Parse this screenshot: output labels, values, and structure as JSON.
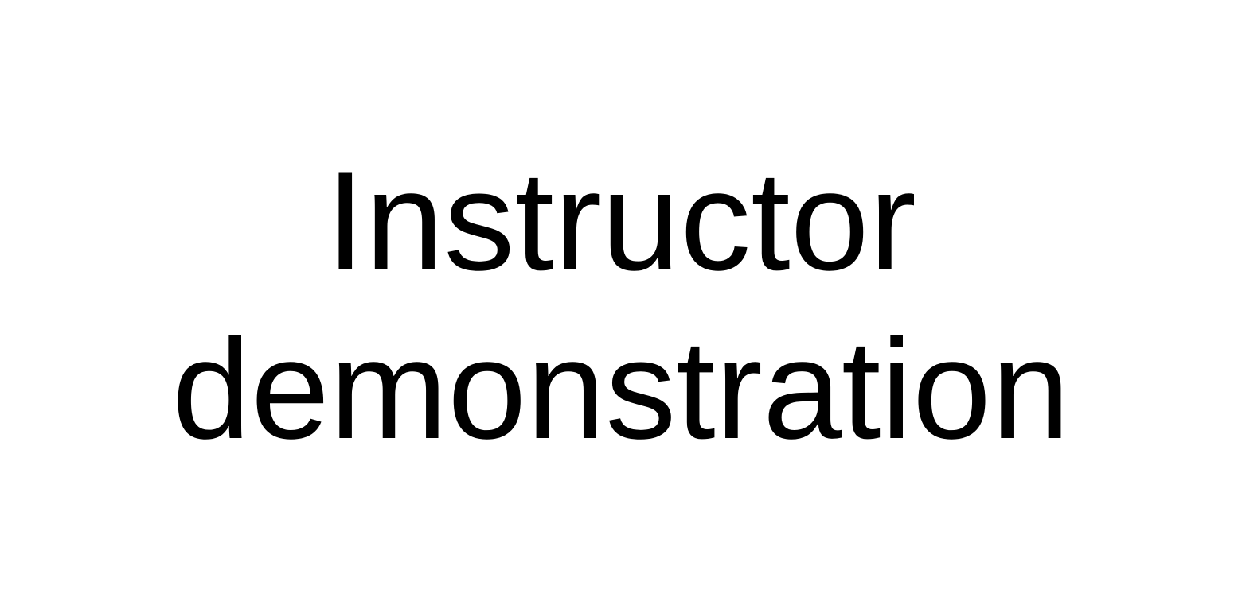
{
  "slide": {
    "title_lines": [
      "Instructor",
      "demonstration"
    ]
  },
  "colors": {
    "background": "#ffffff",
    "text": "#000000"
  }
}
